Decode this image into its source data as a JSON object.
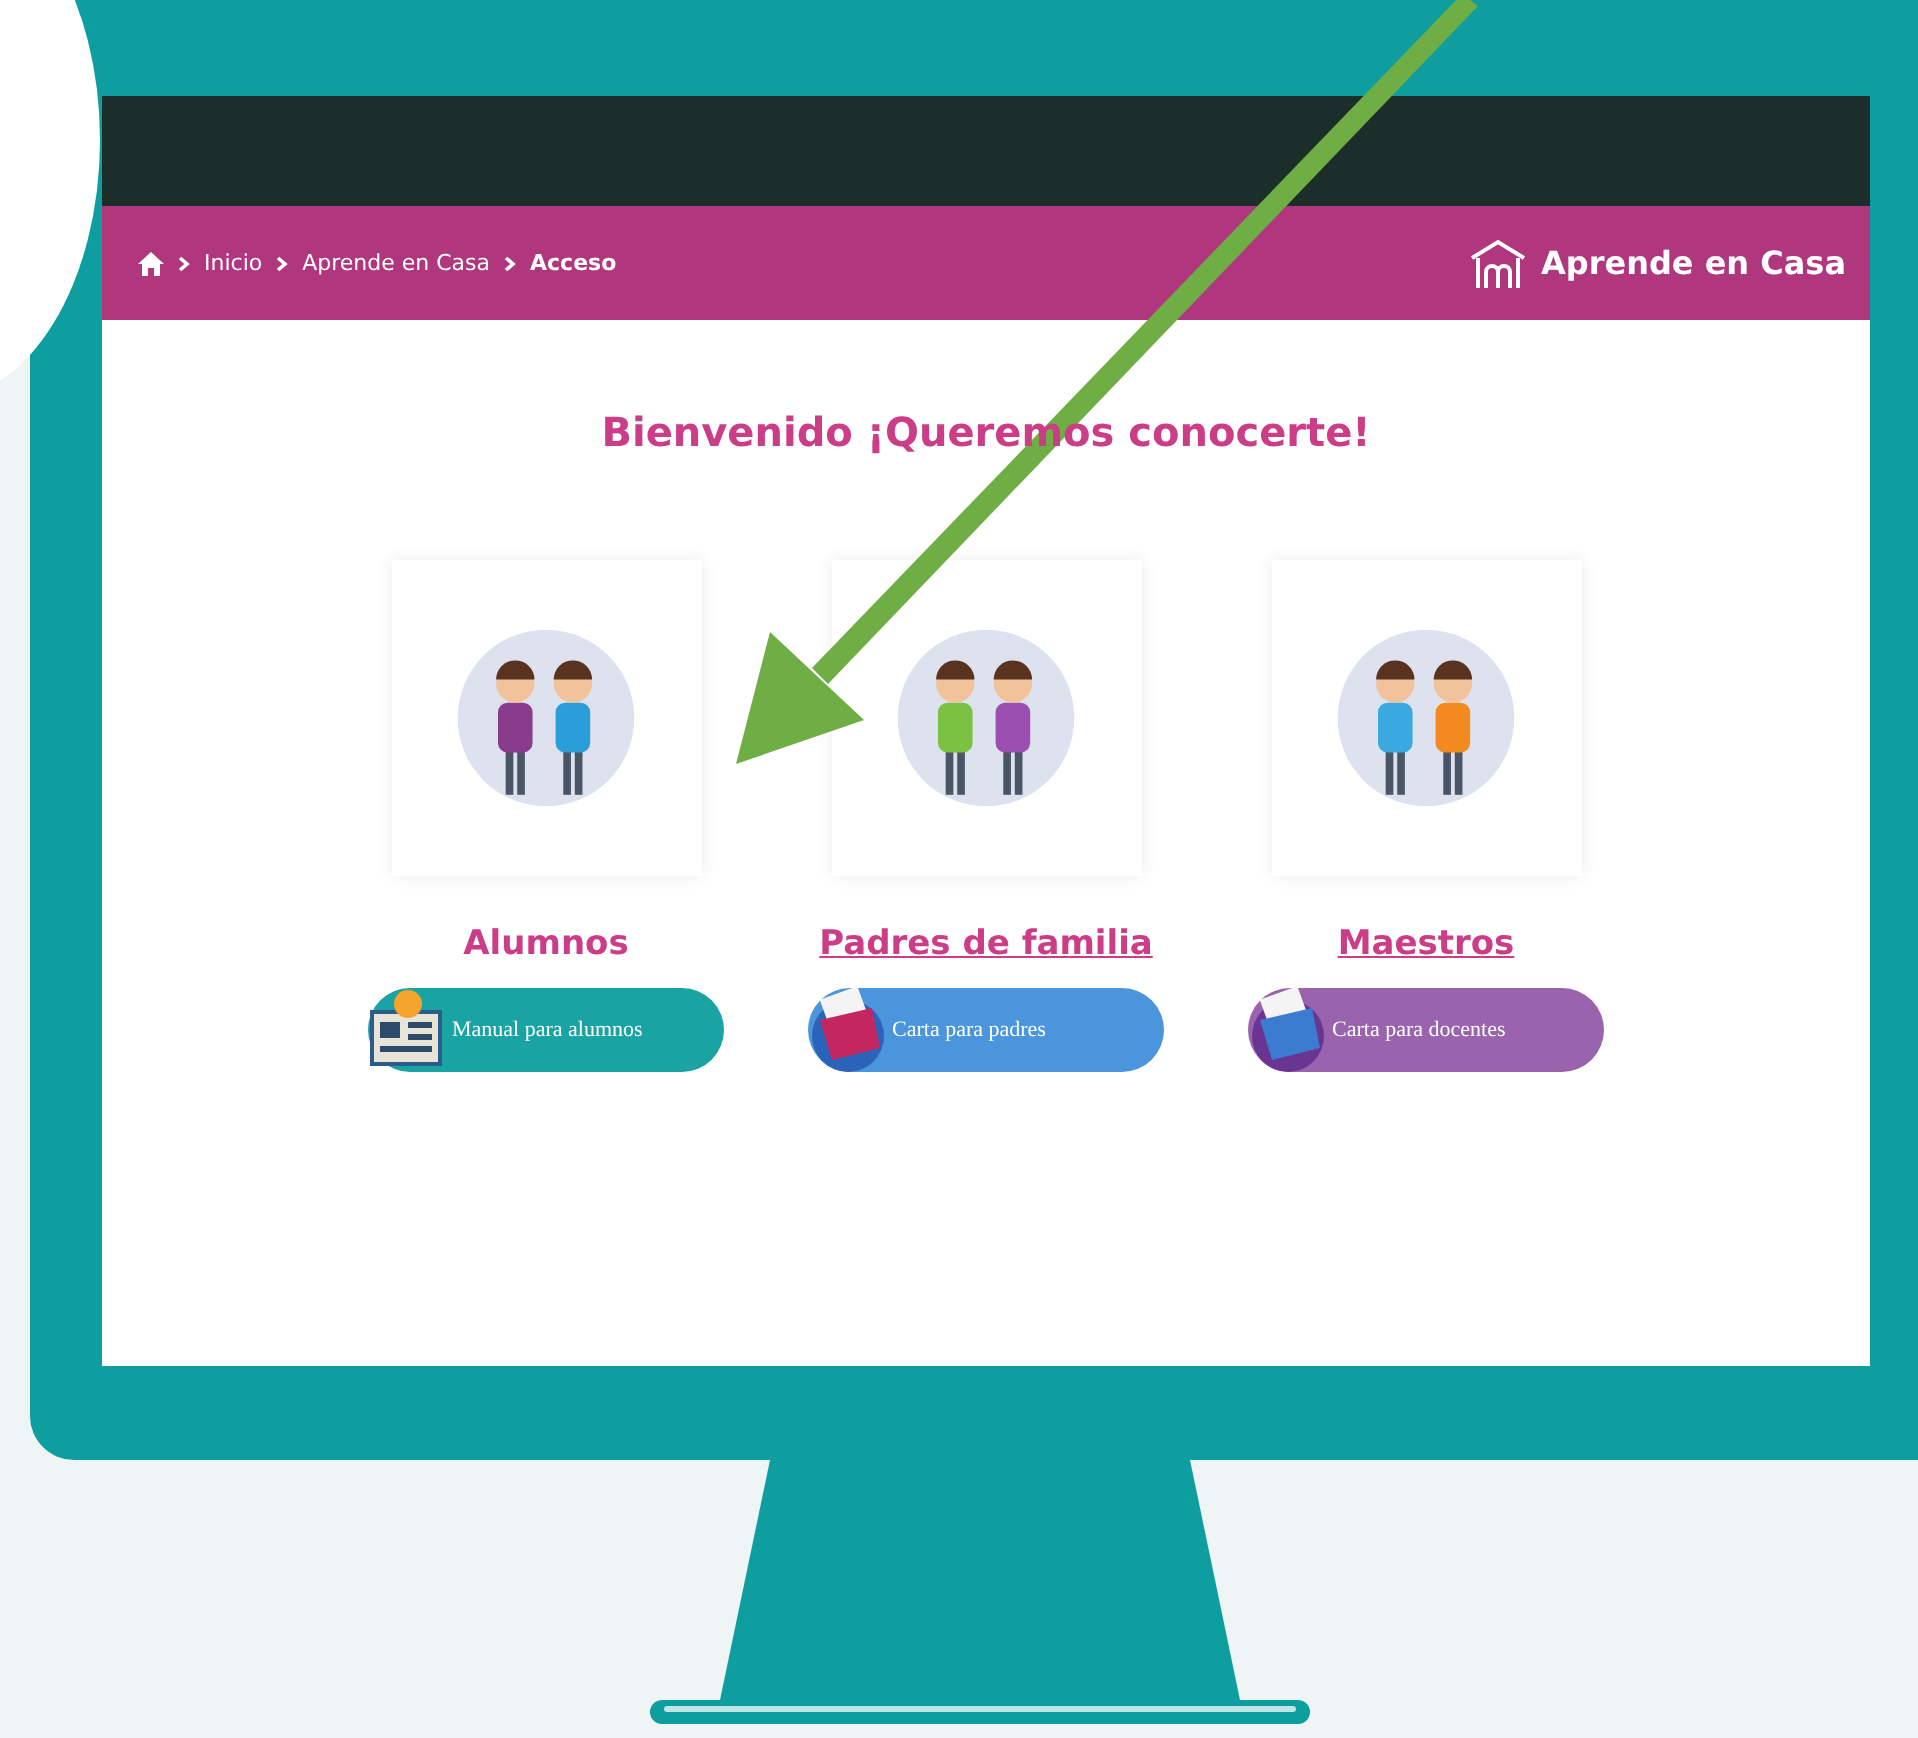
{
  "breadcrumb": [
    {
      "label": "Inicio",
      "current": false
    },
    {
      "label": "Aprende en Casa",
      "current": false
    },
    {
      "label": "Acceso",
      "current": true
    }
  ],
  "logo": {
    "label": "Aprende en Casa"
  },
  "heading": "Bienvenido ¡Queremos conocerte!",
  "profiles": [
    {
      "label": "Alumnos",
      "link": false,
      "button": {
        "label": "Manual para alumnos",
        "color": "#1aa3a3"
      }
    },
    {
      "label": "Padres de familia",
      "link": true,
      "button": {
        "label": "Carta para padres",
        "color": "#4a95dc"
      }
    },
    {
      "label": "Maestros",
      "link": true,
      "button": {
        "label": "Carta para docentes",
        "color": "#9a63ad"
      }
    }
  ]
}
